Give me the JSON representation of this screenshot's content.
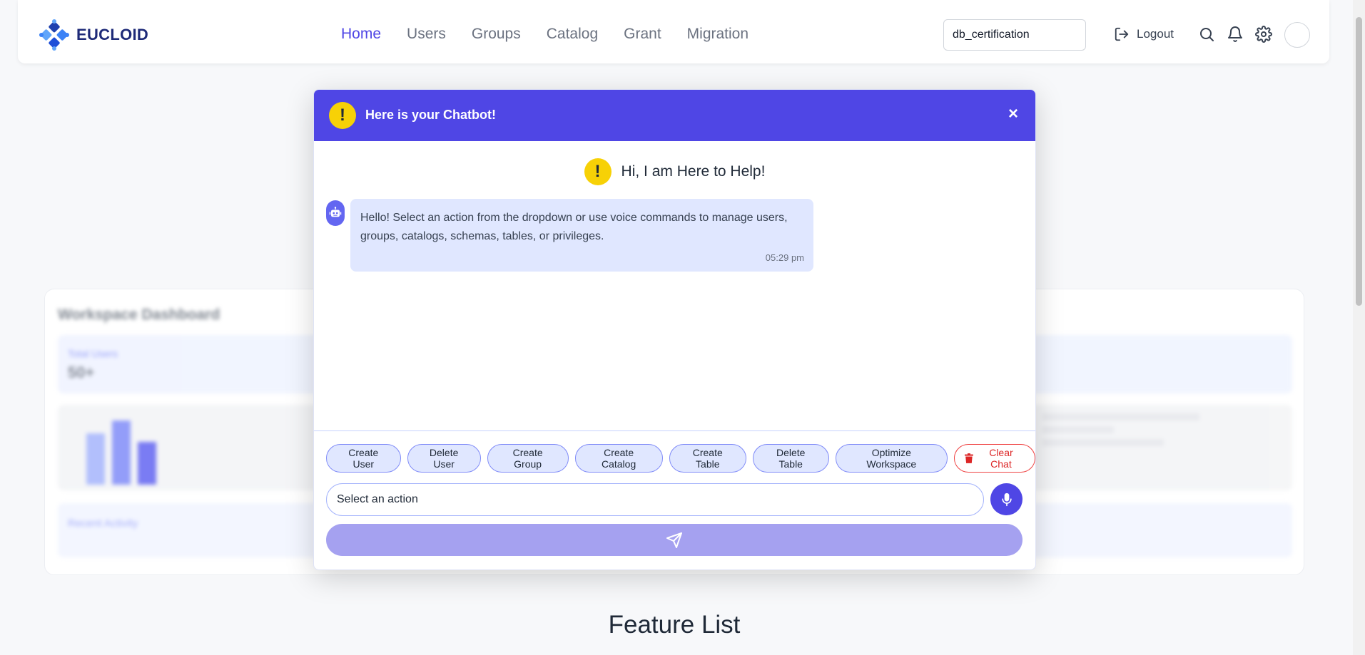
{
  "header": {
    "brand": "EUCLOID",
    "nav": [
      {
        "label": "Home",
        "active": true
      },
      {
        "label": "Users",
        "active": false
      },
      {
        "label": "Groups",
        "active": false
      },
      {
        "label": "Catalog",
        "active": false
      },
      {
        "label": "Grant",
        "active": false
      },
      {
        "label": "Migration",
        "active": false
      }
    ],
    "workspace_value": "db_certification",
    "logout_label": "Logout",
    "icons": [
      "search-icon",
      "bell-icon",
      "gear-icon"
    ]
  },
  "background": {
    "dashboard_title": "Workspace Dashboard",
    "stat_label": "Total Users",
    "stat_value": "50+",
    "recent_label": "Recent Activity",
    "feature_title": "Feature List"
  },
  "chatbot": {
    "title": "Here is your Chatbot!",
    "close_label": "×",
    "greeting": "Hi, I am Here to Help!",
    "message": {
      "text": "Hello! Select an action from the dropdown or use voice commands to manage users, groups, catalogs, schemas, tables, or privileges.",
      "time": "05:29 pm"
    },
    "actions": [
      "Create User",
      "Delete User",
      "Create Group",
      "Create Catalog",
      "Create Table",
      "Delete Table",
      "Optimize Workspace"
    ],
    "clear_label": "Clear Chat",
    "select_value": "Select an action"
  },
  "colors": {
    "accent": "#4f46e5",
    "warning": "#f7d106",
    "danger": "#dc2626",
    "send_disabled": "#a5a1f0"
  }
}
